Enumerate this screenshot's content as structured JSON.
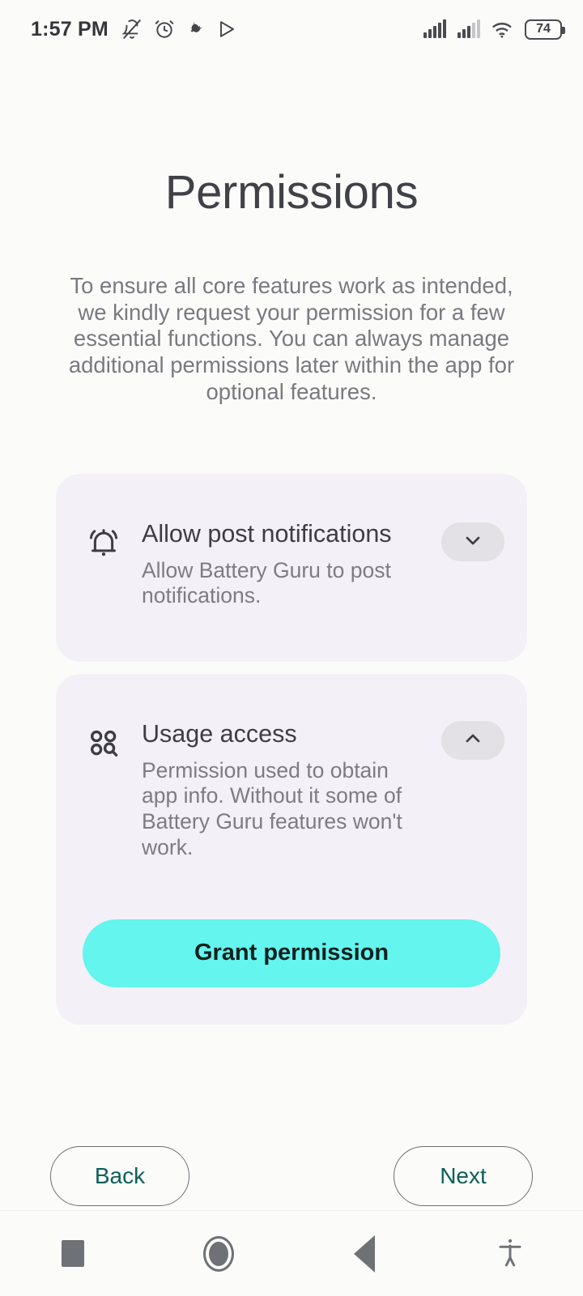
{
  "statusbar": {
    "time": "1:57 PM",
    "left_icons": [
      "bell-off-icon",
      "alarm-icon",
      "charging-plug-icon",
      "play-store-icon"
    ],
    "right_icons": [
      "signal-bars-1-icon",
      "signal-bars-2-icon",
      "wifi-icon"
    ],
    "battery_level": "74"
  },
  "page": {
    "title": "Permissions",
    "description": "To ensure all core features work as intended, we kindly request your permission for a few essential functions. You can always manage additional permissions later within the app for optional features."
  },
  "permissions": [
    {
      "icon": "bell-ringing-icon",
      "title": "Allow post notifications",
      "description": "Allow Battery Guru to post notifications.",
      "toggle_icon": "chevron-down-icon",
      "expanded": false
    },
    {
      "icon": "usage-access-icon",
      "title": "Usage access",
      "description": "Permission used to obtain app info. Without it some of Battery Guru features won't work.",
      "toggle_icon": "chevron-up-icon",
      "expanded": true,
      "action_label": "Grant permission"
    }
  ],
  "footer": {
    "back_label": "Back",
    "next_label": "Next"
  },
  "sysnav": {
    "recents": "recents-square-icon",
    "home": "home-circle-icon",
    "back": "back-triangle-icon",
    "accessibility": "accessibility-icon"
  },
  "colors": {
    "accent_button": "#63f5ee",
    "card_background": "#f4f0f7",
    "link_text": "#0c5f5c",
    "page_background": "#fbfcfa"
  }
}
